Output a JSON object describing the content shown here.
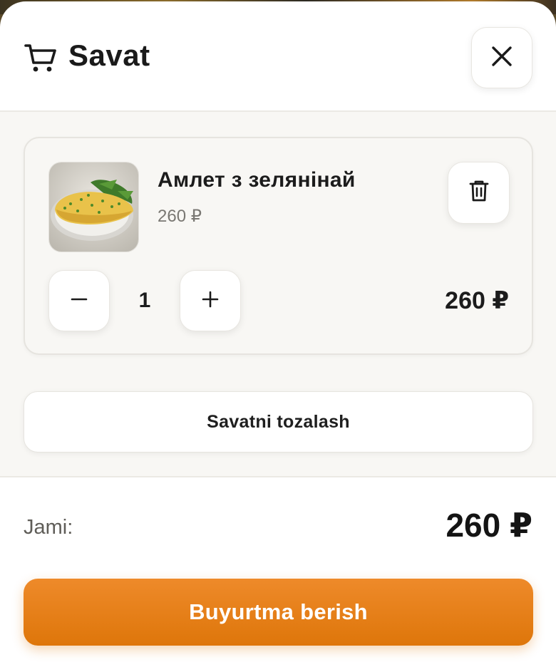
{
  "header": {
    "title": "Savat",
    "icons": {
      "cart": "shopping-cart-icon",
      "close": "close-icon"
    }
  },
  "cart": {
    "items": [
      {
        "name": "Амлет з зелянінай",
        "unit_price": "260 ₽",
        "quantity": "1",
        "line_total": "260 ₽",
        "image": "omelette-with-greens-photo",
        "icons": {
          "delete": "trash-icon",
          "decrease": "minus-icon",
          "increase": "plus-icon"
        }
      }
    ],
    "clear_label": "Savatni tozalash"
  },
  "footer": {
    "total_label": "Jami:",
    "total_value": "260 ₽",
    "order_label": "Buyurtma berish"
  },
  "colors": {
    "accent": "#DE760A",
    "text": "#1A1A1A",
    "muted": "#7A7873",
    "panel": "#F8F7F4"
  }
}
